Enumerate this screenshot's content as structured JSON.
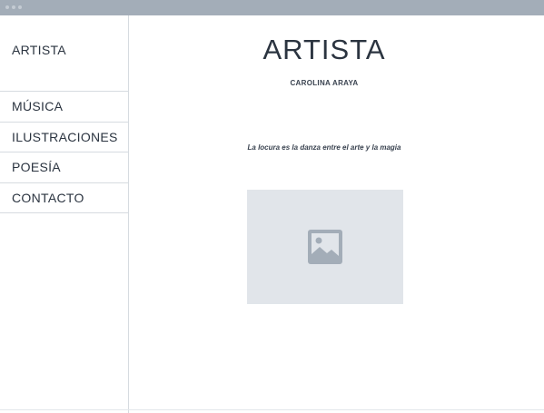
{
  "sidebar": {
    "brand": "ARTISTA",
    "items": [
      {
        "label": "MÚSICA"
      },
      {
        "label": "ILUSTRACIONES"
      },
      {
        "label": "POESÍA"
      },
      {
        "label": "CONTACTO"
      }
    ]
  },
  "main": {
    "title": "ARTISTA",
    "subtitle": "CAROLINA ARAYA",
    "quote": "La locura es la danza entre el arte y la magia",
    "image": {
      "icon": "image-icon"
    }
  },
  "colors": {
    "chrome": "#a3adb8",
    "text": "#2b3440",
    "divider": "#d6dbe0",
    "placeholder": "#e1e5ea",
    "icon": "#a3adb8"
  }
}
